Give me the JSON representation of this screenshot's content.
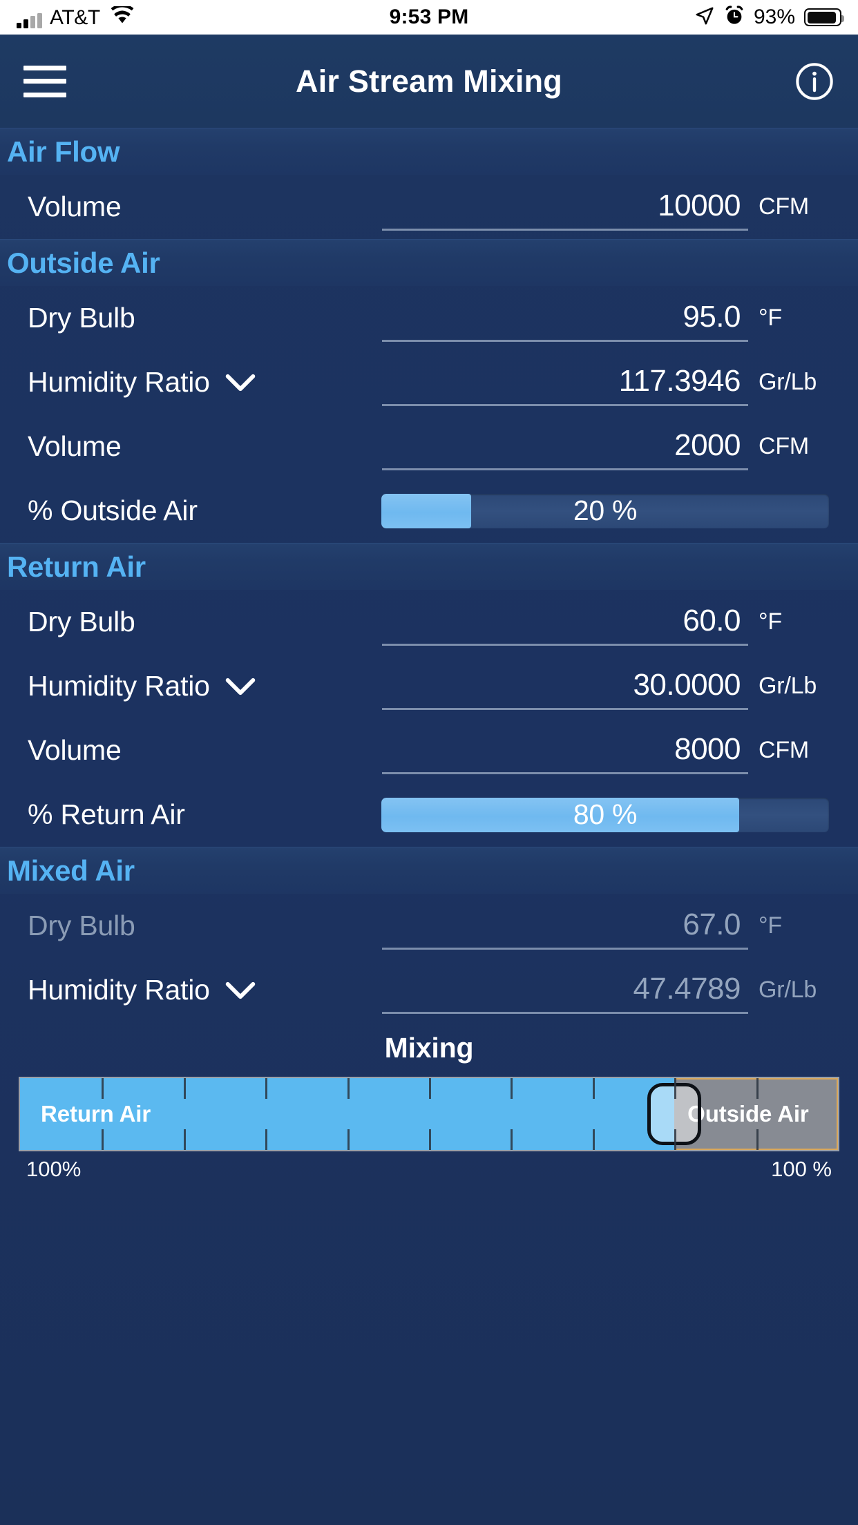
{
  "status_bar": {
    "carrier": "AT&T",
    "time": "9:53 PM",
    "battery_percent": "93%",
    "signal_icon": "cellular-signal-icon",
    "wifi_icon": "wifi-icon",
    "location_icon": "location-arrow-icon",
    "alarm_icon": "alarm-clock-icon",
    "battery_icon": "battery-icon",
    "battery_level": 93
  },
  "nav": {
    "menu_icon": "hamburger-menu-icon",
    "title": "Air Stream Mixing",
    "info_icon": "info-circle-icon"
  },
  "sections": [
    {
      "title": "Air Flow",
      "rows": [
        {
          "label": "Volume",
          "value": "10000",
          "unit": "CFM",
          "type": "field",
          "dimmed": false,
          "chevron": false
        }
      ]
    },
    {
      "title": "Outside Air",
      "rows": [
        {
          "label": "Dry Bulb",
          "value": "95.0",
          "unit": "°F",
          "type": "field",
          "dimmed": false,
          "chevron": false
        },
        {
          "label": "Humidity Ratio",
          "value": "117.3946",
          "unit": "Gr/Lb",
          "type": "field",
          "dimmed": false,
          "chevron": true
        },
        {
          "label": "Volume",
          "value": "2000",
          "unit": "CFM",
          "type": "field",
          "dimmed": false,
          "chevron": false
        },
        {
          "label": "% Outside Air",
          "value": "20 %",
          "percent": 20,
          "type": "progress",
          "dimmed": false,
          "chevron": false
        }
      ]
    },
    {
      "title": "Return Air",
      "rows": [
        {
          "label": "Dry Bulb",
          "value": "60.0",
          "unit": "°F",
          "type": "field",
          "dimmed": false,
          "chevron": false
        },
        {
          "label": "Humidity Ratio",
          "value": "30.0000",
          "unit": "Gr/Lb",
          "type": "field",
          "dimmed": false,
          "chevron": true
        },
        {
          "label": "Volume",
          "value": "8000",
          "unit": "CFM",
          "type": "field",
          "dimmed": false,
          "chevron": false
        },
        {
          "label": "% Return Air",
          "value": "80 %",
          "percent": 80,
          "type": "progress",
          "dimmed": false,
          "chevron": false
        }
      ]
    },
    {
      "title": "Mixed Air",
      "rows": [
        {
          "label": "Dry Bulb",
          "value": "67.0",
          "unit": "°F",
          "type": "field",
          "dimmed": true,
          "chevron": false
        },
        {
          "label": "Humidity Ratio",
          "value": "47.4789",
          "unit": "Gr/Lb",
          "type": "field",
          "dimmed": true,
          "label_bright": true,
          "chevron": true
        }
      ]
    }
  ],
  "mixing": {
    "title": "Mixing",
    "left_label": "Return Air",
    "right_label": "Outside Air",
    "left_scale": "100%",
    "right_scale": "100 %",
    "return_percent": 80,
    "outside_percent": 20,
    "thumb_position_percent": 80,
    "tick_step_percent": 10
  },
  "colors": {
    "background": "#1d3460",
    "section_title": "#55b3f3",
    "accent_blue": "#5bb9f0",
    "track": "#2c4876",
    "outside_gray": "#878b93",
    "outside_border": "#d9a85c",
    "dim_text": "#93a4bd"
  }
}
